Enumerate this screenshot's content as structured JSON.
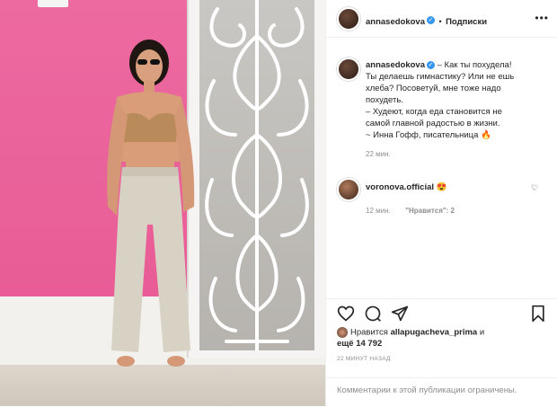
{
  "header": {
    "username": "annasedokova",
    "separator": "•",
    "follow_label": "Подписки",
    "more_icon": "more-horizontal-icon"
  },
  "caption": {
    "username": "annasedokova",
    "lines": [
      " – Как ты похудела!",
      "Ты делаешь гимнастику? Или не ешь",
      "хлеба? Посоветуй, мне тоже надо",
      "похудеть.",
      "– Худеют, когда еда становится не",
      "самой главной радостью в жизни.",
      "~ Инна Гофф, писательница"
    ],
    "emoji": "🔥",
    "time": "22 мин."
  },
  "comment": {
    "username": "voronova.official",
    "emoji": "😍",
    "time": "12 мин.",
    "likes": "\"Нравится\": 2"
  },
  "likes": {
    "prefix": "Нравится ",
    "user": "allapugacheva_prima",
    "suffix": " и",
    "more": "ещё 14 792"
  },
  "timestamp": "22 МИНУТ НАЗАД",
  "footer": "Комментарии к этой публикации ограничены.",
  "colors": {
    "accent_blue": "#3897f0",
    "pink_wall": "#e95c96",
    "muted_text": "#8e8e8e"
  }
}
